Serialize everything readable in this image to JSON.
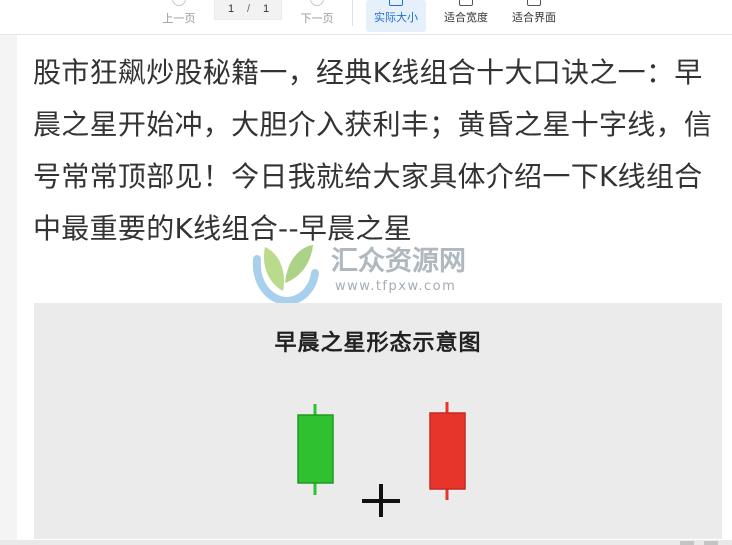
{
  "toolbar": {
    "prev_label": "上一页",
    "next_label": "下一页",
    "current_page": "1",
    "page_separator": "/",
    "total_pages": "1",
    "actual_size_label": "实际大小",
    "fit_width_label": "适合宽度",
    "fit_page_label": "适合界面",
    "active_color": "#1f6fd1",
    "icons": [
      "prev-circle-icon",
      "next-circle-icon",
      "actual-size-icon",
      "fit-width-icon",
      "fit-page-icon"
    ]
  },
  "document": {
    "paragraph": "股市狂飙炒股秘籍一，经典K线组合十大口诀之一：早晨之星开始冲，大胆介入获利丰；黄昏之星十字线，信号常常顶部见！今日我就给大家具体介绍一下K线组合中最重要的K线组合--早晨之星",
    "watermark": {
      "text": "汇众资源网",
      "url": "www.tfpxw.com"
    },
    "figure": {
      "title": "早晨之星形态示意图",
      "symbol": "+",
      "candles": [
        {
          "color": "#2fc12f",
          "kind": "bearish"
        },
        {
          "color": "#e8352b",
          "kind": "bullish"
        }
      ]
    }
  }
}
